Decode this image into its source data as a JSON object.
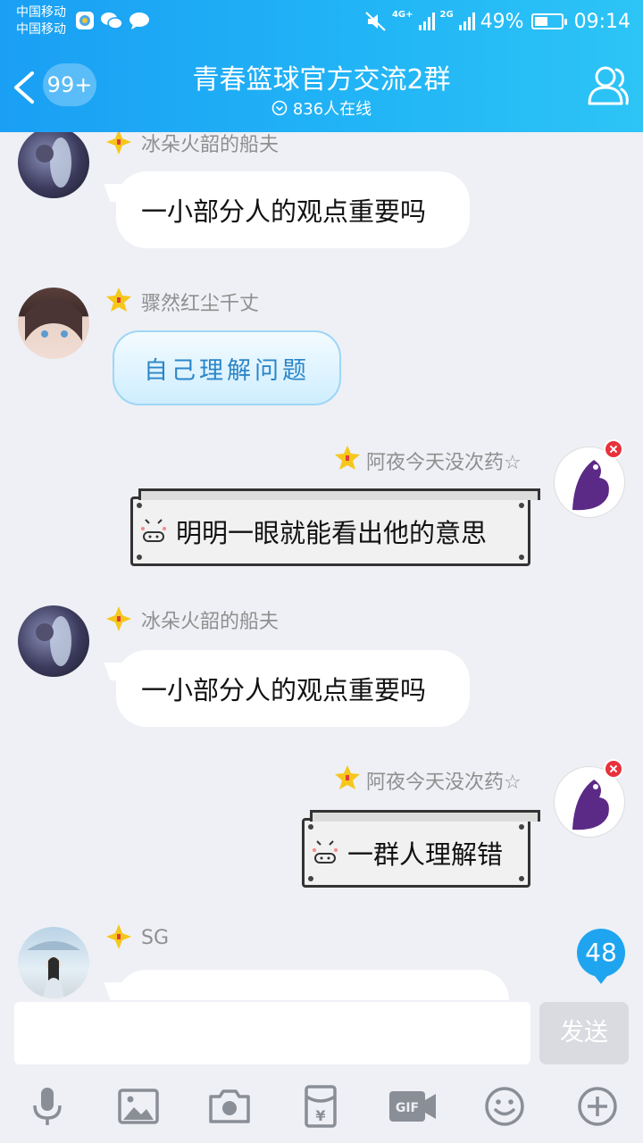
{
  "status_bar": {
    "carrier1": "中国移动",
    "carrier2": "中国移动",
    "net4g": "4G+",
    "net2g": "2G",
    "battery": "49%",
    "time": "09:14"
  },
  "header": {
    "unread_count": "99+",
    "title": "青春篮球官方交流2群",
    "online": "836人在线"
  },
  "messages": [
    {
      "sender": "冰朵火韶的船夫",
      "text": "一小部分人的观点重要吗",
      "side": "left"
    },
    {
      "sender": "骤然红尘千丈",
      "text": "自己理解问题",
      "side": "left"
    },
    {
      "sender": "阿夜今天没次药☆",
      "text": "明明一眼就能看出他的意思",
      "side": "right"
    },
    {
      "sender": "冰朵火韶的船夫",
      "text": "一小部分人的观点重要吗",
      "side": "left"
    },
    {
      "sender": "阿夜今天没次药☆",
      "text": "一群人理解错",
      "side": "right"
    },
    {
      "sender": "SG",
      "text": "",
      "side": "left"
    }
  ],
  "unread_badge": "48",
  "input": {
    "placeholder": "",
    "send_label": "发送"
  },
  "toolbar": [
    "mic-icon",
    "image-icon",
    "camera-icon",
    "red-packet-icon",
    "gif-icon",
    "emoji-icon",
    "plus-icon"
  ],
  "colors": {
    "header": "#1a9ff4",
    "accent": "#1fa5ef",
    "background": "#eef0f5"
  }
}
